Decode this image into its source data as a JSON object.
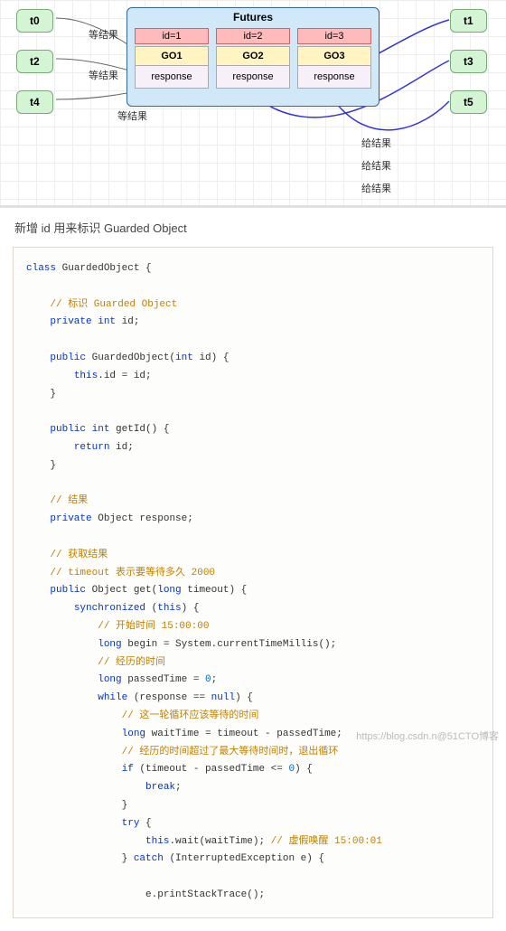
{
  "diagram": {
    "left_threads": [
      "t0",
      "t2",
      "t4"
    ],
    "right_threads": [
      "t1",
      "t3",
      "t5"
    ],
    "wait_label": "等结果",
    "give_label": "给结果",
    "futures": {
      "title": "Futures",
      "cols": [
        {
          "id": "id=1",
          "go": "GO1",
          "resp": "response"
        },
        {
          "id": "id=2",
          "go": "GO2",
          "resp": "response"
        },
        {
          "id": "id=3",
          "go": "GO3",
          "resp": "response"
        }
      ]
    }
  },
  "caption": "新增 id 用来标识 Guarded Object",
  "code": {
    "l1a": "class",
    "l1b": " GuardedObject {",
    "c1": "// 标识 Guarded Object",
    "l2a": "private",
    "l2b": " int",
    "l2c": " id;",
    "l3a": "public",
    "l3b": " GuardedObject(",
    "l3c": "int",
    "l3d": " id) {",
    "l4a": "this",
    "l4b": ".id = id;",
    "l5": "}",
    "l6a": "public",
    "l6b": " int",
    "l6c": " getId() {",
    "l7a": "return",
    "l7b": " id;",
    "l8": "}",
    "c2": "// 结果",
    "l9a": "private",
    "l9b": " Object response;",
    "c3": "// 获取结果",
    "c4": "// timeout 表示要等待多久 2000",
    "l10a": "public",
    "l10b": " Object get(",
    "l10c": "long",
    "l10d": " timeout) {",
    "l11a": "synchronized",
    "l11b": " (",
    "l11c": "this",
    "l11d": ") {",
    "c5": "// 开始时间 15:00:00",
    "l12a": "long",
    "l12b": " begin = System.currentTimeMillis();",
    "c6": "// 经历的时间",
    "l13a": "long",
    "l13b": " passedTime = ",
    "l13c": "0",
    "l13d": ";",
    "l14a": "while",
    "l14b": " (response == ",
    "l14c": "null",
    "l14d": ") {",
    "c7": "// 这一轮循环应该等待的时间",
    "l15a": "long",
    "l15b": " waitTime = timeout - passedTime;",
    "c8": "// 经历的时间超过了最大等待时间时，退出循环",
    "l16a": "if",
    "l16b": " (timeout - passedTime <= ",
    "l16c": "0",
    "l16d": ") {",
    "l17a": "break",
    "l17b": ";",
    "l18": "}",
    "l19a": "try",
    "l19b": " {",
    "l20a": "this",
    "l20b": ".wait(waitTime); ",
    "l20c": "// 虚假唤醒 15:00:01",
    "l21a": "} ",
    "l21b": "catch",
    "l21c": " (InterruptedException e) {",
    "l22": "e.printStackTrace();"
  },
  "watermark": "https://blog.csdn.n@51CTO博客"
}
